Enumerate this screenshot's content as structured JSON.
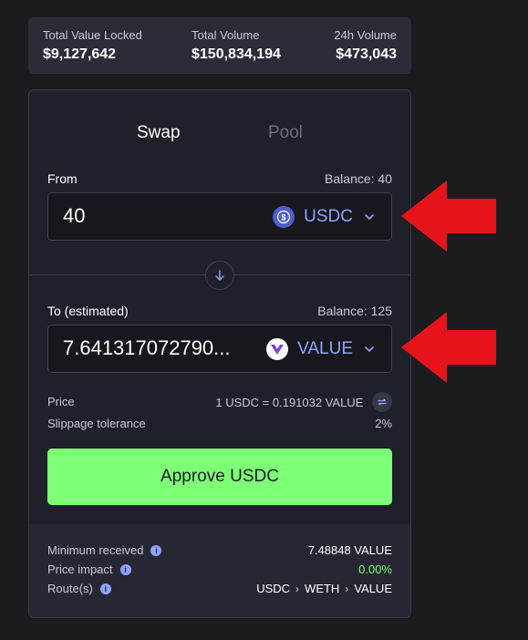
{
  "stats": {
    "tvl_label": "Total Value Locked",
    "tvl_value": "$9,127,642",
    "volume_label": "Total Volume",
    "volume_value": "$150,834,194",
    "volume24_label": "24h Volume",
    "volume24_value": "$473,043"
  },
  "tabs": {
    "swap": "Swap",
    "pool": "Pool"
  },
  "from": {
    "label": "From",
    "balance": "Balance: 40",
    "amount": "40",
    "token": "USDC",
    "token_icon": "usdc-coin-icon"
  },
  "to": {
    "label": "To (estimated)",
    "balance": "Balance: 125",
    "amount": "7.641317072790...",
    "token": "VALUE",
    "token_icon": "value-coin-icon"
  },
  "info": {
    "price_label": "Price",
    "price_value": "1 USDC = 0.191032 VALUE",
    "slippage_label": "Slippage tolerance",
    "slippage_value": "2%"
  },
  "approve_label": "Approve USDC",
  "footer": {
    "min_received_label": "Minimum received",
    "min_received_value": "7.48848 VALUE",
    "price_impact_label": "Price impact",
    "price_impact_value": "0.00%",
    "route_label": "Route(s)",
    "route": [
      "USDC",
      "WETH",
      "VALUE"
    ]
  },
  "colors": {
    "accent_green": "#7dff76",
    "token_blue": "#8ea4ff",
    "annotation_red": "#e8141b"
  }
}
